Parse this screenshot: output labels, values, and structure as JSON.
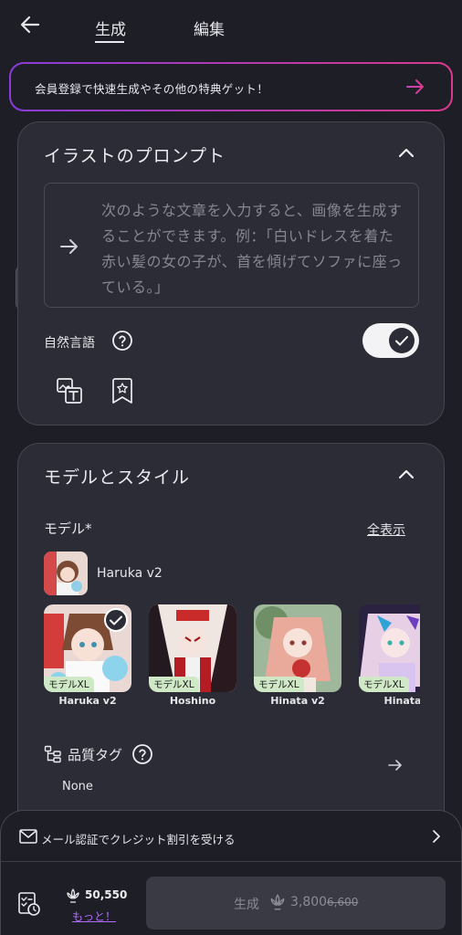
{
  "nav": {
    "tabs": [
      {
        "label": "生成"
      },
      {
        "label": "編集"
      }
    ]
  },
  "promo": {
    "text": "会員登録で快速生成やその他の特典ゲット！"
  },
  "prompt_section": {
    "title": "イラストのプロンプト",
    "placeholder": "次のような文章を入力すると、画像を生成することができます。例：｢白いドレスを着た赤い髪の女の子が、首を傾げてソファに座っている。｣",
    "natural_language_label": "自然言語",
    "natural_language_enabled": true
  },
  "model_section": {
    "title": "モデルとスタイル",
    "model_label": "モデル*",
    "show_all": "全表示",
    "selected_model": "Haruka v2",
    "models": [
      {
        "name": "Haruka v2",
        "badge": "モデルXL",
        "selected": true
      },
      {
        "name": "Hoshino",
        "badge": "モデルXL",
        "selected": false
      },
      {
        "name": "Hinata v2",
        "badge": "モデルXL",
        "selected": false
      },
      {
        "name": "Hinata",
        "badge": "モデルXL",
        "selected": false
      }
    ],
    "quality_tag_label": "品質タグ",
    "quality_tag_value": "None"
  },
  "bottom": {
    "mail_text": "メール認証でクレジット割引を受ける",
    "credits": "50,550",
    "more_label": "もっと！",
    "generate_label": "生成",
    "cost": "3,800",
    "old_cost": "6,600"
  },
  "colors": {
    "background": "#1e1e27",
    "card": "#2c2c36",
    "promo_gradient_start": "#8b3bd8",
    "promo_gradient_end": "#d83a8c",
    "badge": "#cfe9c7",
    "link": "#b06bff"
  }
}
